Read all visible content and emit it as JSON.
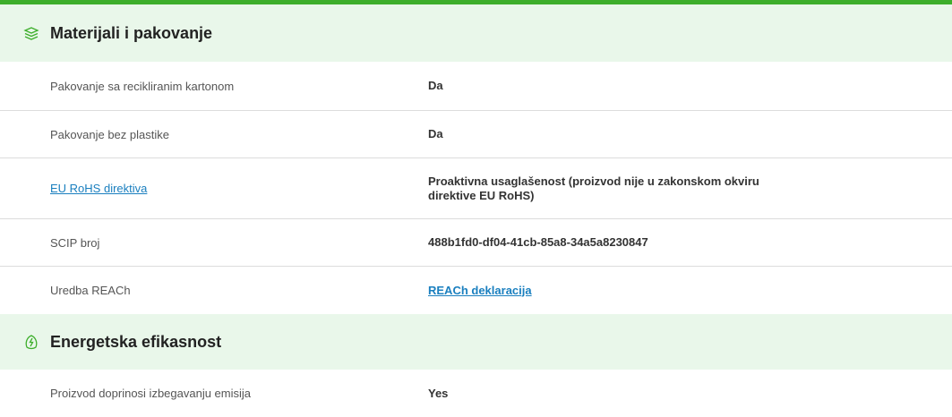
{
  "colors": {
    "accent": "#3dae2b",
    "section_bg": "#e9f7ea",
    "link": "#1a7fbf"
  },
  "materials": {
    "title": "Materijali i pakovanje",
    "icon": "layers-leaf-icon",
    "rows": [
      {
        "label": "Pakovanje sa recikliranim kartonom",
        "value": "Da"
      },
      {
        "label": "Pakovanje bez plastike",
        "value": "Da"
      },
      {
        "label": "EU RoHS direktiva",
        "value": "Proaktivna usaglašenost (proizvod nije u zakonskom okviru direktive EU RoHS)"
      },
      {
        "label": "SCIP broj",
        "value": "488b1fd0-df04-41cb-85a8-34a5a8230847"
      },
      {
        "label": "Uredba REACh",
        "value": "REACh deklaracija"
      }
    ]
  },
  "energy": {
    "title": "Energetska efikasnost",
    "icon": "energy-leaf-icon",
    "rows": [
      {
        "label": "Proizvod doprinosi izbegavanju emisija",
        "value": "Yes"
      }
    ]
  }
}
